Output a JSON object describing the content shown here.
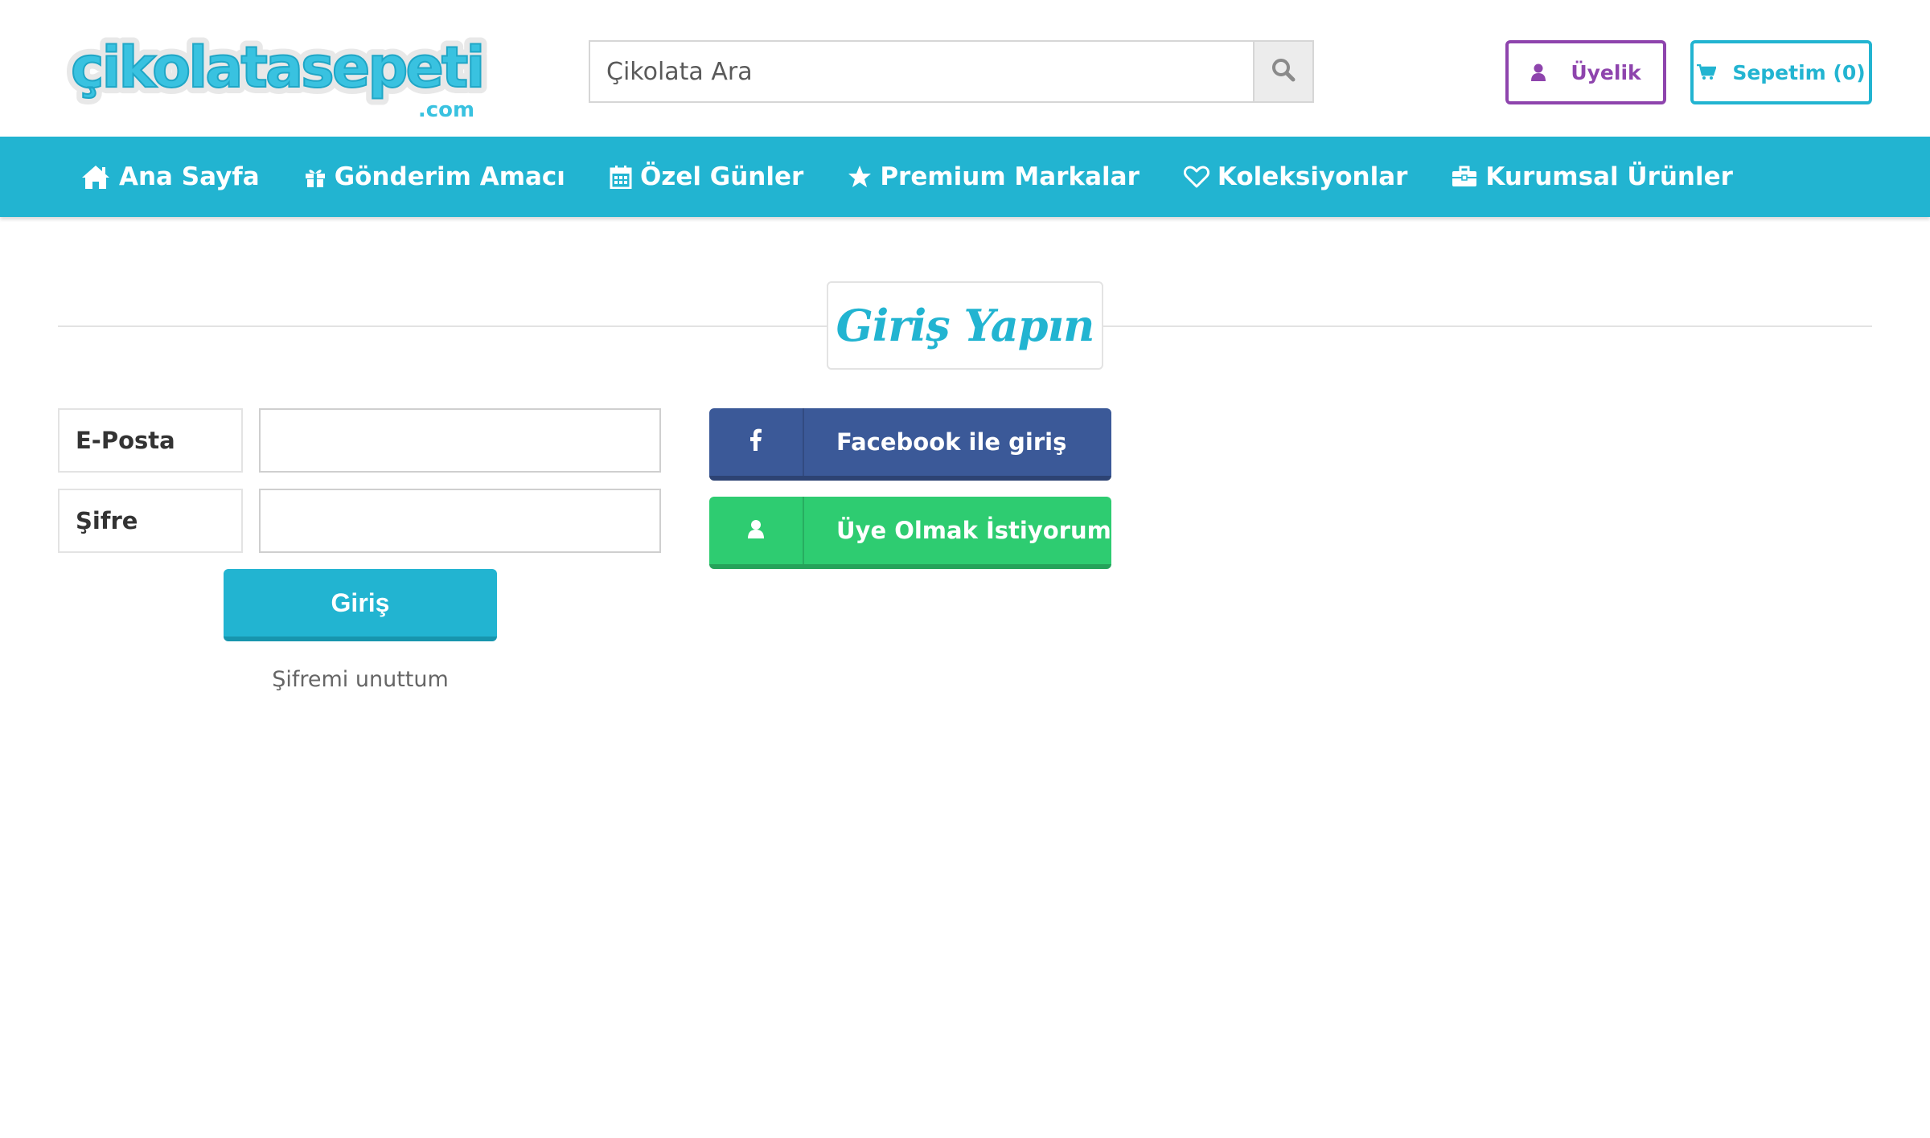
{
  "header": {
    "logo_text": "çikolatasepeti",
    "logo_suffix": ".com",
    "search": {
      "placeholder": "Çikolata Ara",
      "icon": "search-icon"
    },
    "member_button": {
      "label": "Üyelik",
      "icon": "user-icon",
      "color": "#8e44ad"
    },
    "cart_button": {
      "label": "Sepetim (0)",
      "icon": "cart-icon",
      "color": "#22b4d1"
    }
  },
  "nav": {
    "background": "#22b4d1",
    "items": [
      {
        "label": "Ana Sayfa",
        "icon": "home-icon"
      },
      {
        "label": "Gönderim Amacı",
        "icon": "gift-icon"
      },
      {
        "label": "Özel Günler",
        "icon": "calendar-icon"
      },
      {
        "label": "Premium Markalar",
        "icon": "star-icon"
      },
      {
        "label": "Koleksiyonlar",
        "icon": "heart-icon"
      },
      {
        "label": "Kurumsal Ürünler",
        "icon": "briefcase-icon"
      }
    ]
  },
  "login": {
    "title": "Giriş Yapın",
    "email_label": "E-Posta",
    "password_label": "Şifre",
    "email_value": "",
    "password_value": "",
    "submit_label": "Giriş",
    "forgot_label": "Şifremi unuttum"
  },
  "social": {
    "facebook_label": "Facebook ile giriş",
    "facebook_icon": "facebook-icon",
    "facebook_color": "#3b5998",
    "register_label": "Üye Olmak İstiyorum",
    "register_icon": "user-icon",
    "register_color": "#2ecc71"
  }
}
